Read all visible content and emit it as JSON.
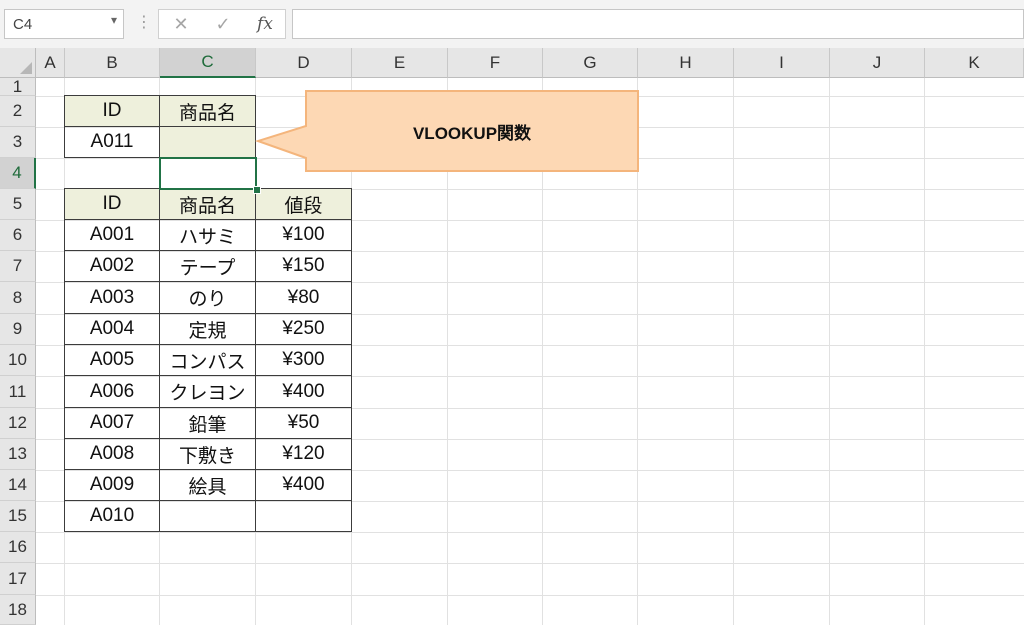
{
  "formula_bar": {
    "name_box": "C4",
    "name_box_arrow": "▾",
    "grip": "⋮",
    "cancel_icon": "✕",
    "enter_icon": "✓",
    "fx_label": "fx",
    "formula": ""
  },
  "columns": [
    "A",
    "B",
    "C",
    "D",
    "E",
    "F",
    "G",
    "H",
    "I",
    "J",
    "K"
  ],
  "rows": [
    "1",
    "2",
    "3",
    "4",
    "5",
    "6",
    "7",
    "8",
    "9",
    "10",
    "11",
    "12",
    "13",
    "14",
    "15",
    "16",
    "17",
    "18"
  ],
  "active_cell": "C4",
  "lookup": {
    "header_id": "ID",
    "header_name": "商品名",
    "id_value": "A011",
    "name_value": ""
  },
  "table": {
    "headers": [
      "ID",
      "商品名",
      "値段"
    ],
    "rows": [
      [
        "A001",
        "ハサミ",
        "¥100"
      ],
      [
        "A002",
        "テープ",
        "¥150"
      ],
      [
        "A003",
        "のり",
        "¥80"
      ],
      [
        "A004",
        "定規",
        "¥250"
      ],
      [
        "A005",
        "コンパス",
        "¥300"
      ],
      [
        "A006",
        "クレヨン",
        "¥400"
      ],
      [
        "A007",
        "鉛筆",
        "¥50"
      ],
      [
        "A008",
        "下敷き",
        "¥120"
      ],
      [
        "A009",
        "絵具",
        "¥400"
      ],
      [
        "A010",
        "",
        ""
      ]
    ]
  },
  "callout": {
    "text": "VLOOKUP関数"
  },
  "colors": {
    "accent_green": "#217346",
    "header_fill": "#eef0dc",
    "callout_fill": "#fdd8b4",
    "callout_border": "#f4b57c"
  }
}
